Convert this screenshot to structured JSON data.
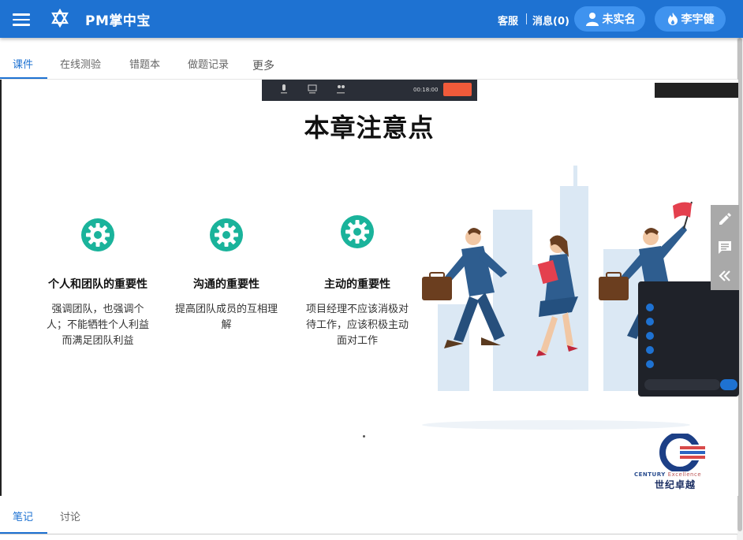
{
  "app": {
    "title": "PM掌中宝"
  },
  "topbar": {
    "service": "客服",
    "messages": "消息(0)",
    "verify": "未实名",
    "user": "李宇健"
  },
  "tabs": [
    {
      "label": "课件",
      "active": true
    },
    {
      "label": "在线测验",
      "active": false
    },
    {
      "label": "错题本",
      "active": false
    },
    {
      "label": "做题记录",
      "active": false
    },
    {
      "label": "更多",
      "active": false
    }
  ],
  "slide": {
    "title": "本章注意点",
    "points": [
      {
        "heading": "个人和团队的重要性",
        "text": "强调团队，也强调个人；不能牺牲个人利益而满足团队利益"
      },
      {
        "heading": "沟通的重要性",
        "text": "提高团队成员的互相理解"
      },
      {
        "heading": "主动的重要性",
        "text": "项目经理不应该消极对待工作，应该积极主动面对工作"
      }
    ],
    "logo_text_en": "CENTURY",
    "logo_text_en2": "Excellence",
    "logo_text_cn": "世纪卓越"
  },
  "colors": {
    "primary": "#1e72d2",
    "teal": "#1ab39b",
    "pill": "#3f93ef"
  },
  "icons": {
    "menu": "menu-icon",
    "app": "star-icon",
    "user": "user-icon",
    "flame": "flame-icon",
    "edit": "pencil-icon",
    "comment": "comment-icon",
    "collapse": "double-chevron-left-icon"
  },
  "bottom_tabs": [
    {
      "label": "笔记",
      "active": true
    },
    {
      "label": "讨论",
      "active": false
    }
  ]
}
